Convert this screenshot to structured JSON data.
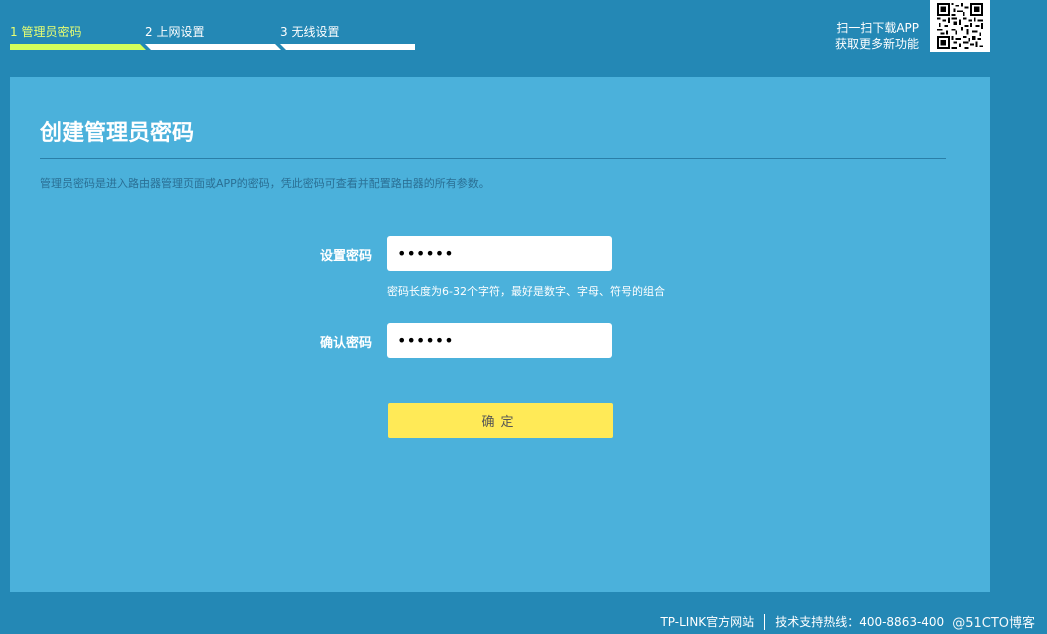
{
  "steps": [
    {
      "label": "1 管理员密码",
      "active": true
    },
    {
      "label": "2 上网设置",
      "active": false
    },
    {
      "label": "3 无线设置",
      "active": false
    }
  ],
  "app": {
    "line1": "扫一扫下载APP",
    "line2": "获取更多新功能",
    "qr_icon": "qr-code-icon"
  },
  "panel": {
    "title": "创建管理员密码",
    "description": "管理员密码是进入路由器管理页面或APP的密码，凭此密码可查看并配置路由器的所有参数。"
  },
  "form": {
    "set_password_label": "设置密码",
    "set_password_value": "••••••",
    "hint": "密码长度为6-32个字符，最好是数字、字母、符号的组合",
    "confirm_password_label": "确认密码",
    "confirm_password_value": "••••••",
    "confirm_button": "确定"
  },
  "footer": {
    "website": "TP-LINK官方网站",
    "hotline": "技术支持热线：400-8863-400",
    "watermark": "@51CTO博客"
  },
  "colors": {
    "background": "#2488b5",
    "panel": "#4bb1db",
    "active_step": "#d4ff5a",
    "button": "#ffea57"
  }
}
